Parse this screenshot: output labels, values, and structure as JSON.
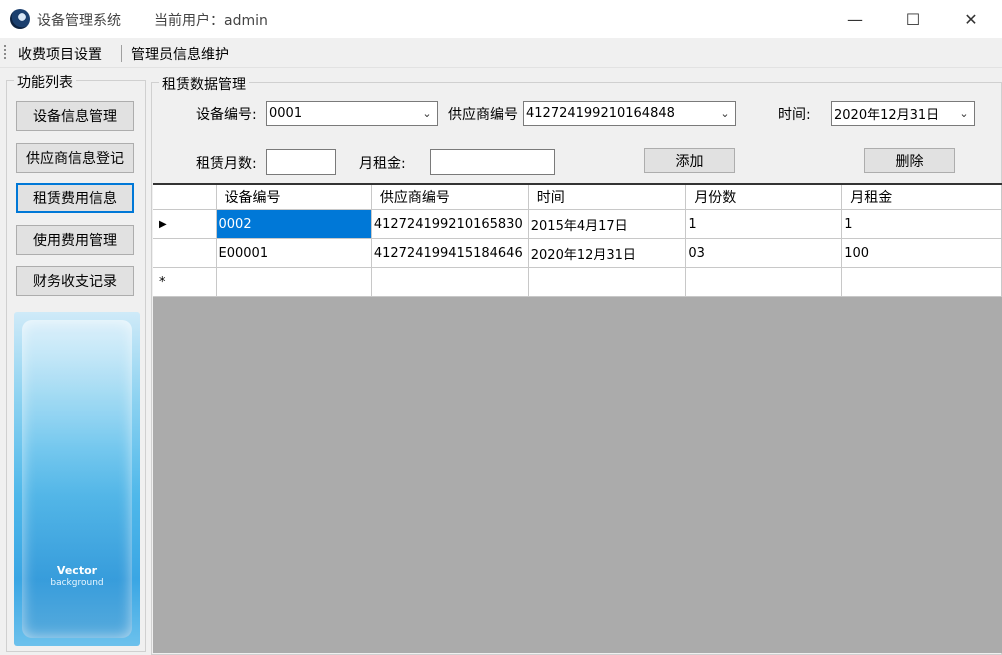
{
  "window": {
    "title": "设备管理系统",
    "user_label": "当前用户：admin",
    "minimize": "—",
    "maximize": "☐",
    "close": "✕"
  },
  "menu": {
    "items": [
      {
        "label": "收费项目设置"
      },
      {
        "label": "管理员信息维护"
      }
    ]
  },
  "left_panel": {
    "legend": "功能列表",
    "buttons": [
      {
        "label": "设备信息管理"
      },
      {
        "label": "供应商信息登记"
      },
      {
        "label": "租赁费用信息"
      },
      {
        "label": "使用费用管理"
      },
      {
        "label": "财务收支记录"
      }
    ],
    "banner": {
      "title": "Vector",
      "subtitle": "background"
    }
  },
  "form": {
    "legend": "租赁数据管理",
    "device_label": "设备编号:",
    "device_value": "0001",
    "supplier_label": "供应商编号",
    "supplier_value": "412724199210164848",
    "time_label": "时间:",
    "time_value": "2020年12月31日",
    "months_label": "租赁月数:",
    "months_value": "",
    "rent_label": "月租金:",
    "rent_value": "",
    "add_label": "添加",
    "delete_label": "删除"
  },
  "grid": {
    "columns": [
      "设备编号",
      "供应商编号",
      "时间",
      "月份数",
      "月租金"
    ],
    "rows": [
      [
        "0002",
        "412724199210165830",
        "2015年4月17日",
        "1",
        "1"
      ],
      [
        "E00001",
        "412724199415184646",
        "2020年12月31日",
        "03",
        "100"
      ]
    ],
    "current_row_marker": "▶",
    "new_row_marker": "*"
  },
  "colors": {
    "selection": "#0078d7",
    "grid_background": "#ababab",
    "window_background": "#f0f0f0"
  }
}
